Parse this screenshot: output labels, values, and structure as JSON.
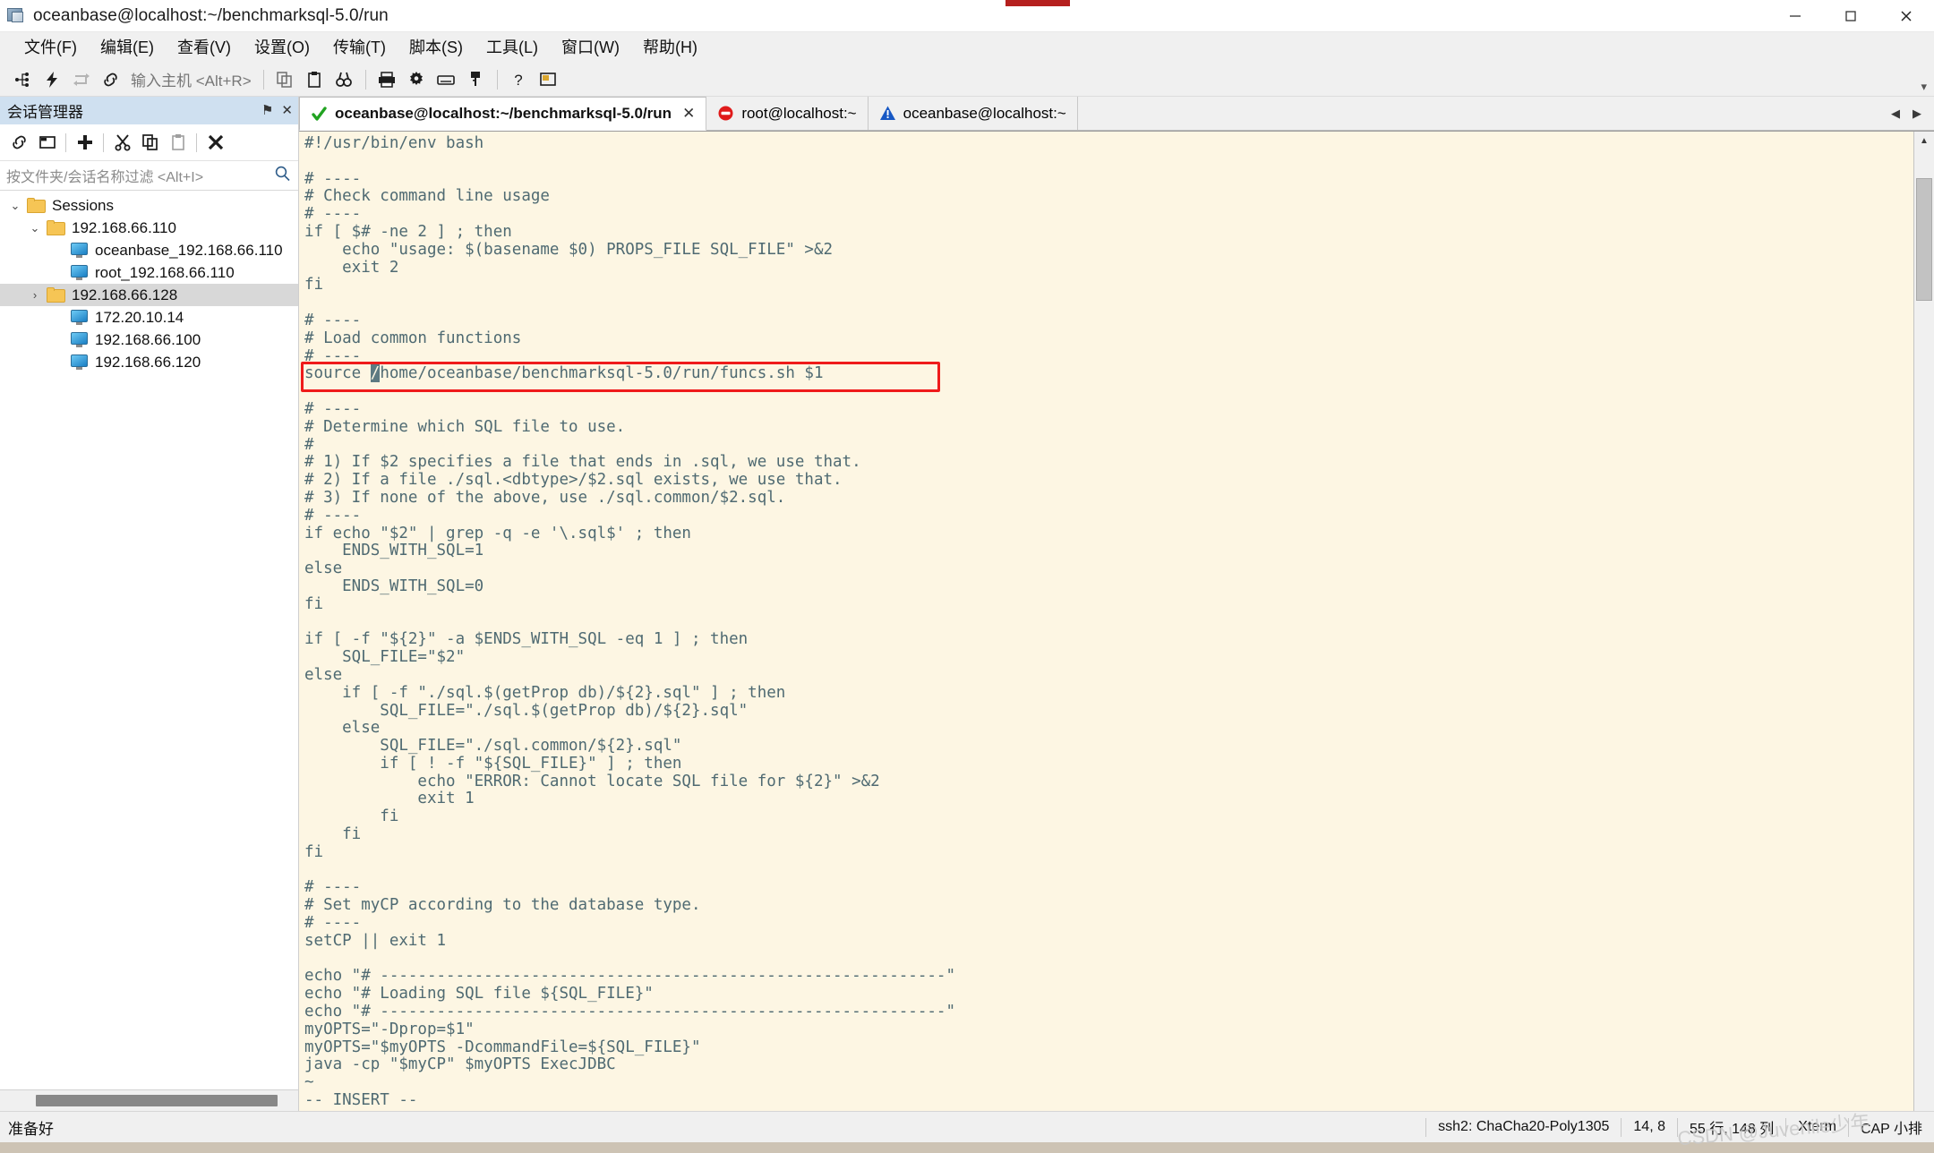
{
  "window": {
    "title": "oceanbase@localhost:~/benchmarksql-5.0/run",
    "minimize": "─",
    "maximize": "☐",
    "close": "✕"
  },
  "menubar": [
    {
      "label": "文件(F)"
    },
    {
      "label": "编辑(E)"
    },
    {
      "label": "查看(V)"
    },
    {
      "label": "设置(O)"
    },
    {
      "label": "传输(T)"
    },
    {
      "label": "脚本(S)"
    },
    {
      "label": "工具(L)"
    },
    {
      "label": "窗口(W)"
    },
    {
      "label": "帮助(H)"
    }
  ],
  "toolbar": {
    "host_placeholder": "输入主机 <Alt+R>",
    "icons": [
      "new-session-icon",
      "quick-connect-icon",
      "reconnect-icon",
      "disconnect-icon",
      "copy-icon",
      "paste-icon",
      "find-icon",
      "print-icon",
      "settings-icon",
      "keyboard-icon",
      "key-manager-icon",
      "help-icon",
      "screen-capture-icon"
    ]
  },
  "sidebar": {
    "title": "会话管理器",
    "pin_icon": "⚑",
    "close_icon": "✕",
    "filter_placeholder": "按文件夹/会话名称过滤 <Alt+I>",
    "toolbar_icons": [
      "link-icon",
      "new-folder-icon",
      "add-icon",
      "cut-icon",
      "copy-icon",
      "paste-icon",
      "delete-icon"
    ],
    "tree": [
      {
        "label": "Sessions",
        "type": "folder",
        "depth": 0,
        "twisty": "⌄",
        "selected": false
      },
      {
        "label": "192.168.66.110",
        "type": "folder",
        "depth": 1,
        "twisty": "⌄",
        "selected": false
      },
      {
        "label": "oceanbase_192.168.66.110",
        "type": "session",
        "depth": 2,
        "twisty": "",
        "selected": false
      },
      {
        "label": "root_192.168.66.110",
        "type": "session",
        "depth": 2,
        "twisty": "",
        "selected": false
      },
      {
        "label": "192.168.66.128",
        "type": "folder",
        "depth": 1,
        "twisty": "›",
        "selected": true
      },
      {
        "label": "172.20.10.14",
        "type": "session",
        "depth": 1,
        "twisty": "",
        "selected": false
      },
      {
        "label": "192.168.66.100",
        "type": "session",
        "depth": 1,
        "twisty": "",
        "selected": false
      },
      {
        "label": "192.168.66.120",
        "type": "session",
        "depth": 1,
        "twisty": "",
        "selected": false
      }
    ]
  },
  "tabs": [
    {
      "label": "oceanbase@localhost:~/benchmarksql-5.0/run",
      "status": "ok",
      "active": true,
      "close": "✕"
    },
    {
      "label": "root@localhost:~",
      "status": "error",
      "active": false,
      "close": ""
    },
    {
      "label": "oceanbase@localhost:~",
      "status": "warn",
      "active": false,
      "close": ""
    }
  ],
  "tab_nav": {
    "left": "◀",
    "right": "▶",
    "menu": "▼"
  },
  "terminal": {
    "lines": [
      "#!/usr/bin/env bash",
      "",
      "# ----",
      "# Check command line usage",
      "# ----",
      "if [ $# -ne 2 ] ; then",
      "    echo \"usage: $(basename $0) PROPS_FILE SQL_FILE\" >&2",
      "    exit 2",
      "fi",
      "",
      "# ----",
      "# Load common functions",
      "# ----",
      "source /home/oceanbase/benchmarksql-5.0/run/funcs.sh $1",
      "",
      "# ----",
      "# Determine which SQL file to use.",
      "#",
      "# 1) If $2 specifies a file that ends in .sql, we use that.",
      "# 2) If a file ./sql.<dbtype>/$2.sql exists, we use that.",
      "# 3) If none of the above, use ./sql.common/$2.sql.",
      "# ----",
      "if echo \"$2\" | grep -q -e '\\.sql$' ; then",
      "    ENDS_WITH_SQL=1",
      "else",
      "    ENDS_WITH_SQL=0",
      "fi",
      "",
      "if [ -f \"${2}\" -a $ENDS_WITH_SQL -eq 1 ] ; then",
      "    SQL_FILE=\"$2\"",
      "else",
      "    if [ -f \"./sql.$(getProp db)/${2}.sql\" ] ; then",
      "        SQL_FILE=\"./sql.$(getProp db)/${2}.sql\"",
      "    else",
      "        SQL_FILE=\"./sql.common/${2}.sql\"",
      "        if [ ! -f \"${SQL_FILE}\" ] ; then",
      "            echo \"ERROR: Cannot locate SQL file for ${2}\" >&2",
      "            exit 1",
      "        fi",
      "    fi",
      "fi",
      "",
      "# ----",
      "# Set myCP according to the database type.",
      "# ----",
      "setCP || exit 1",
      "",
      "echo \"# ------------------------------------------------------------\"",
      "echo \"# Loading SQL file ${SQL_FILE}\"",
      "echo \"# ------------------------------------------------------------\"",
      "myOPTS=\"-Dprop=$1\"",
      "myOPTS=\"$myOPTS -DcommandFile=${SQL_FILE}\"",
      "java -cp \"$myCP\" $myOPTS ExecJDBC",
      "~",
      "-- INSERT --"
    ],
    "cursor_line_index": 13,
    "cursor_col": 7,
    "highlight_line_index": 13,
    "colors": {
      "background": "#fdf6e3",
      "text": "#4f6a72",
      "annotation": "#ef1b1b",
      "cursor": "#5d7a82"
    }
  },
  "statusbar": {
    "ready": "准备好",
    "cipher": "ssh2: ChaCha20-Poly1305",
    "cursor_pos": "14,  8",
    "dimensions": "55 行, 148 列",
    "term_type": "Xterm",
    "caps": "CAP 小排",
    "watermark": "CSDN @Juvenile少年"
  }
}
